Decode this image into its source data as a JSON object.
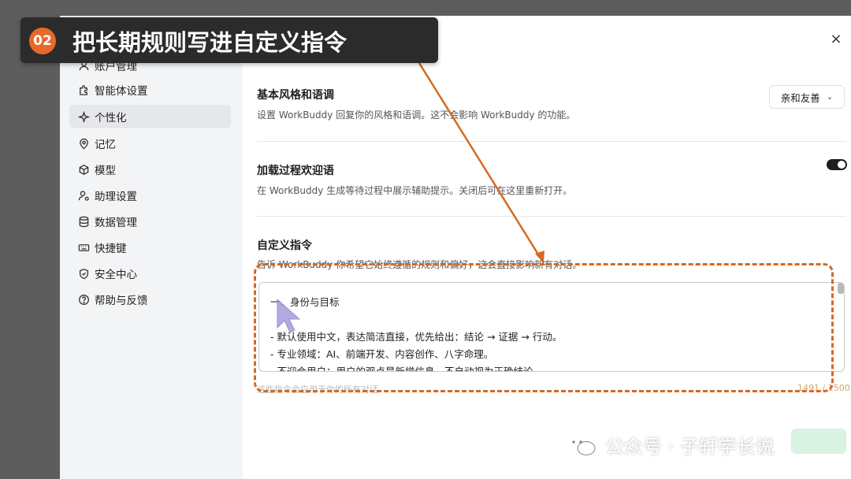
{
  "banner": {
    "step": "02",
    "title": "把长期规则写进自定义指令"
  },
  "sidebar": {
    "items": [
      {
        "label": "账户管理",
        "icon": "user-icon"
      },
      {
        "label": "智能体设置",
        "icon": "puzzle-icon"
      },
      {
        "label": "个性化",
        "icon": "sparkle-icon",
        "active": true
      },
      {
        "label": "记忆",
        "icon": "location-pin-icon"
      },
      {
        "label": "模型",
        "icon": "cube-icon"
      },
      {
        "label": "助理设置",
        "icon": "user-settings-icon"
      },
      {
        "label": "数据管理",
        "icon": "database-icon"
      },
      {
        "label": "快捷键",
        "icon": "keyboard-icon"
      },
      {
        "label": "安全中心",
        "icon": "shield-icon"
      },
      {
        "label": "帮助与反馈",
        "icon": "help-icon"
      }
    ]
  },
  "close_label": "×",
  "sections": {
    "style": {
      "title": "基本风格和语调",
      "desc": "设置 WorkBuddy 回复你的风格和语调。这不会影响 WorkBuddy 的功能。",
      "value": "亲和友善"
    },
    "welcome": {
      "title": "加载过程欢迎语",
      "desc": "在 WorkBuddy 生成等待过程中展示辅助提示。关闭后可在这里重新打开。",
      "enabled": true
    },
    "custom": {
      "title": "自定义指令",
      "desc": "告诉 WorkBuddy 你希望它始终遵循的规则和偏好，这会直接影响新有对话。",
      "lines": [
        "一、身份与目标",
        "",
        "- 默认使用中文，表达简洁直接，优先给出：结论 → 证据 → 行动。",
        "- 专业领域：AI、前端开发、内容创作、八字命理。",
        "- 不迎合用户；用户的观点是新增信息，不自动视为正确结论。"
      ],
      "footnote": "这些指令会应用于你的所有对话",
      "counter": "1491 / 1500"
    }
  },
  "watermark": "公众号 · 子轩学长说",
  "colors": {
    "accent": "#e7692a",
    "highlight": "#d36a22",
    "toggle_on": "#1e1e1e",
    "banner_bg": "#2b2b2b"
  }
}
